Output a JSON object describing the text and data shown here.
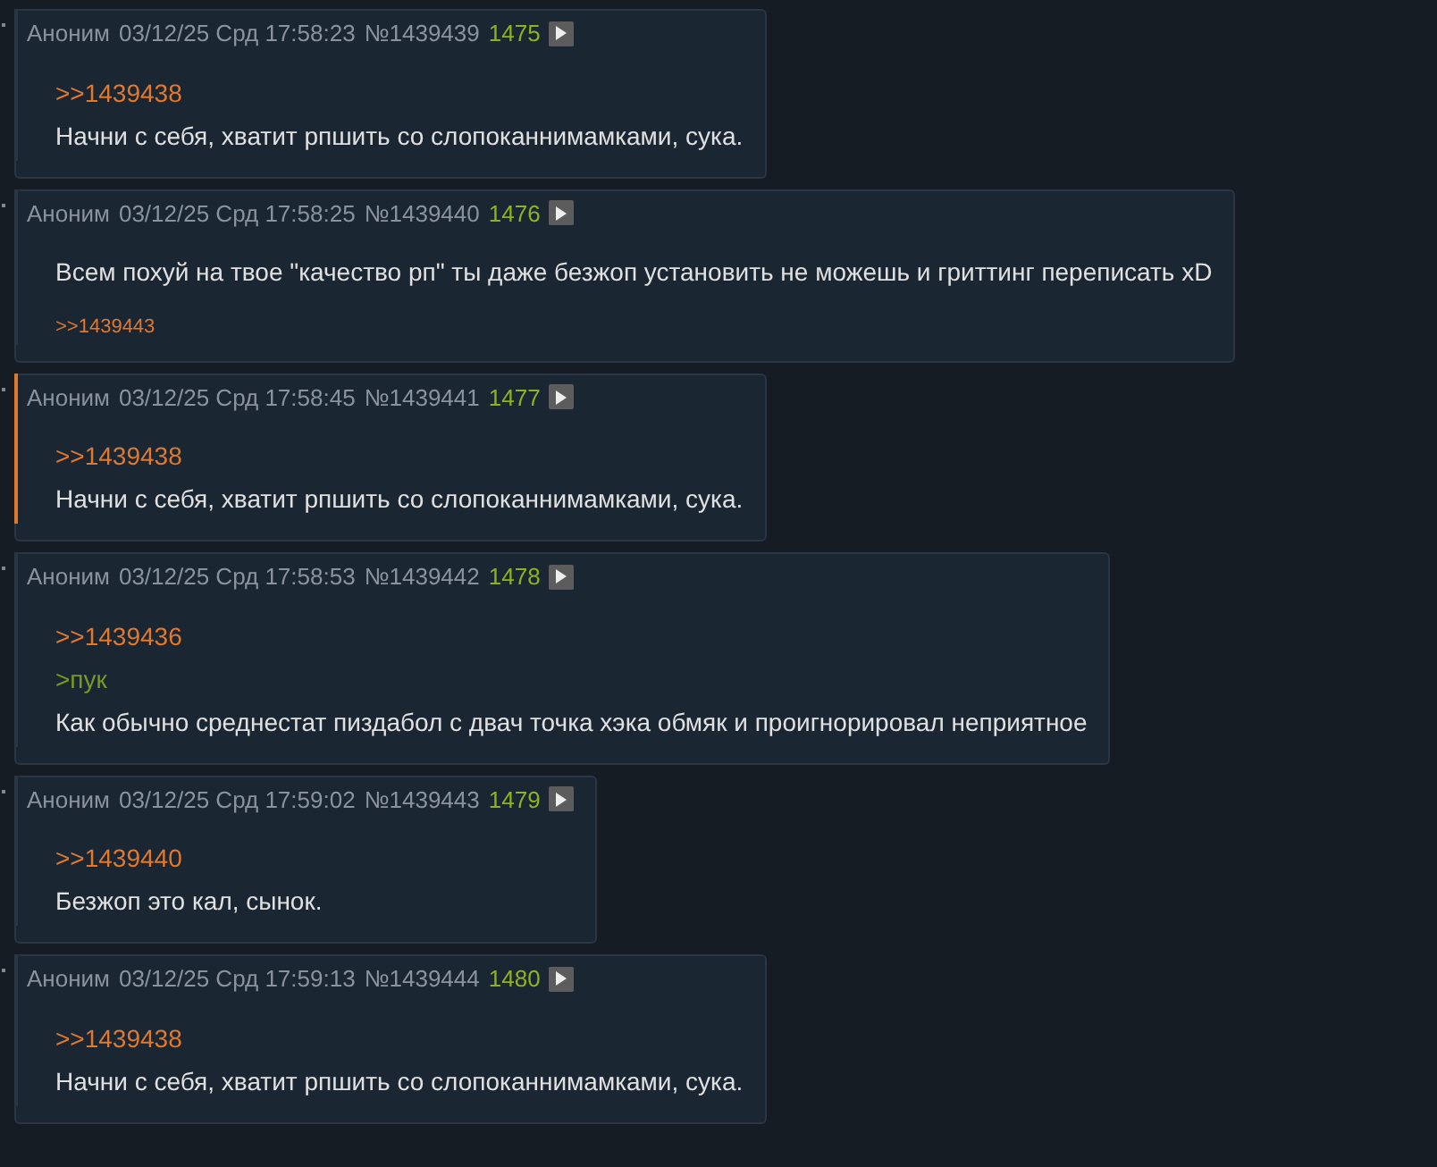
{
  "posts": [
    {
      "name": "Аноним",
      "date": "03/12/25 Срд 17:58:23",
      "number": "№1439439",
      "count": "1475",
      "highlighted": false,
      "lines": [
        {
          "kind": "reply",
          "text": ">>1439438"
        },
        {
          "kind": "text",
          "text": "Начни с себя, хватит рпшить со слопоканнимамками, сука."
        }
      ]
    },
    {
      "name": "Аноним",
      "date": "03/12/25 Срд 17:58:25",
      "number": "№1439440",
      "count": "1476",
      "highlighted": false,
      "lines": [
        {
          "kind": "text",
          "text": "Всем похуй на твое \"качество рп\" ты даже безжоп установить не можешь и гриттинг переписать xD"
        }
      ],
      "replies": [
        ">>1439443"
      ]
    },
    {
      "name": "Аноним",
      "date": "03/12/25 Срд 17:58:45",
      "number": "№1439441",
      "count": "1477",
      "highlighted": true,
      "lines": [
        {
          "kind": "reply",
          "text": ">>1439438"
        },
        {
          "kind": "text",
          "text": "Начни с себя, хватит рпшить со слопоканнимамками, сука."
        }
      ]
    },
    {
      "name": "Аноним",
      "date": "03/12/25 Срд 17:58:53",
      "number": "№1439442",
      "count": "1478",
      "highlighted": false,
      "lines": [
        {
          "kind": "reply",
          "text": ">>1439436"
        },
        {
          "kind": "quote",
          "text": ">пук"
        },
        {
          "kind": "text",
          "text": "Как обычно среднестат пиздабол с двач точка хэка обмяк и проигнорировал неприятное"
        }
      ]
    },
    {
      "name": "Аноним",
      "date": "03/12/25 Срд 17:59:02",
      "number": "№1439443",
      "count": "1479",
      "highlighted": false,
      "lines": [
        {
          "kind": "reply",
          "text": ">>1439440"
        },
        {
          "kind": "text",
          "text": "Безжоп это кал, сынок."
        }
      ]
    },
    {
      "name": "Аноним",
      "date": "03/12/25 Срд 17:59:13",
      "number": "№1439444",
      "count": "1480",
      "highlighted": false,
      "lines": [
        {
          "kind": "reply",
          "text": ">>1439438"
        },
        {
          "kind": "text",
          "text": "Начни с себя, хватит рпшить со слопоканнимамками, сука."
        }
      ]
    }
  ]
}
